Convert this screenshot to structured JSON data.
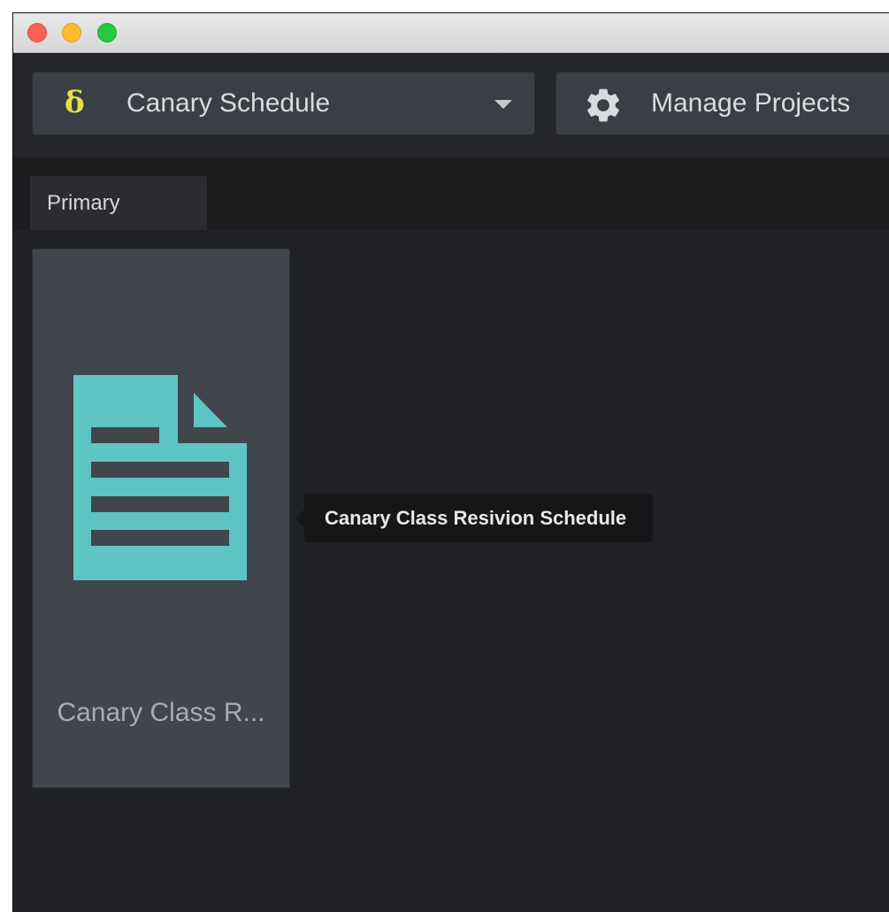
{
  "project_selector": {
    "icon": "delta-icon",
    "icon_glyph": "δ",
    "icon_color": "#e8de4a",
    "selected_project": "Canary Schedule",
    "caret_icon": "chevron-down-icon"
  },
  "toolbar": {
    "manage_icon": "gear-icon",
    "manage_label": "Manage Projects"
  },
  "tabs": [
    {
      "label": "Primary",
      "active": true
    }
  ],
  "items": [
    {
      "icon": "document-icon",
      "icon_color": "#5ec4c4",
      "title": "Canary Class R..."
    }
  ],
  "tooltip": {
    "text": "Canary Class Resivion Schedule"
  },
  "colors": {
    "accent": "#5ec4c4",
    "delta": "#e8de4a",
    "background": "#202124"
  }
}
